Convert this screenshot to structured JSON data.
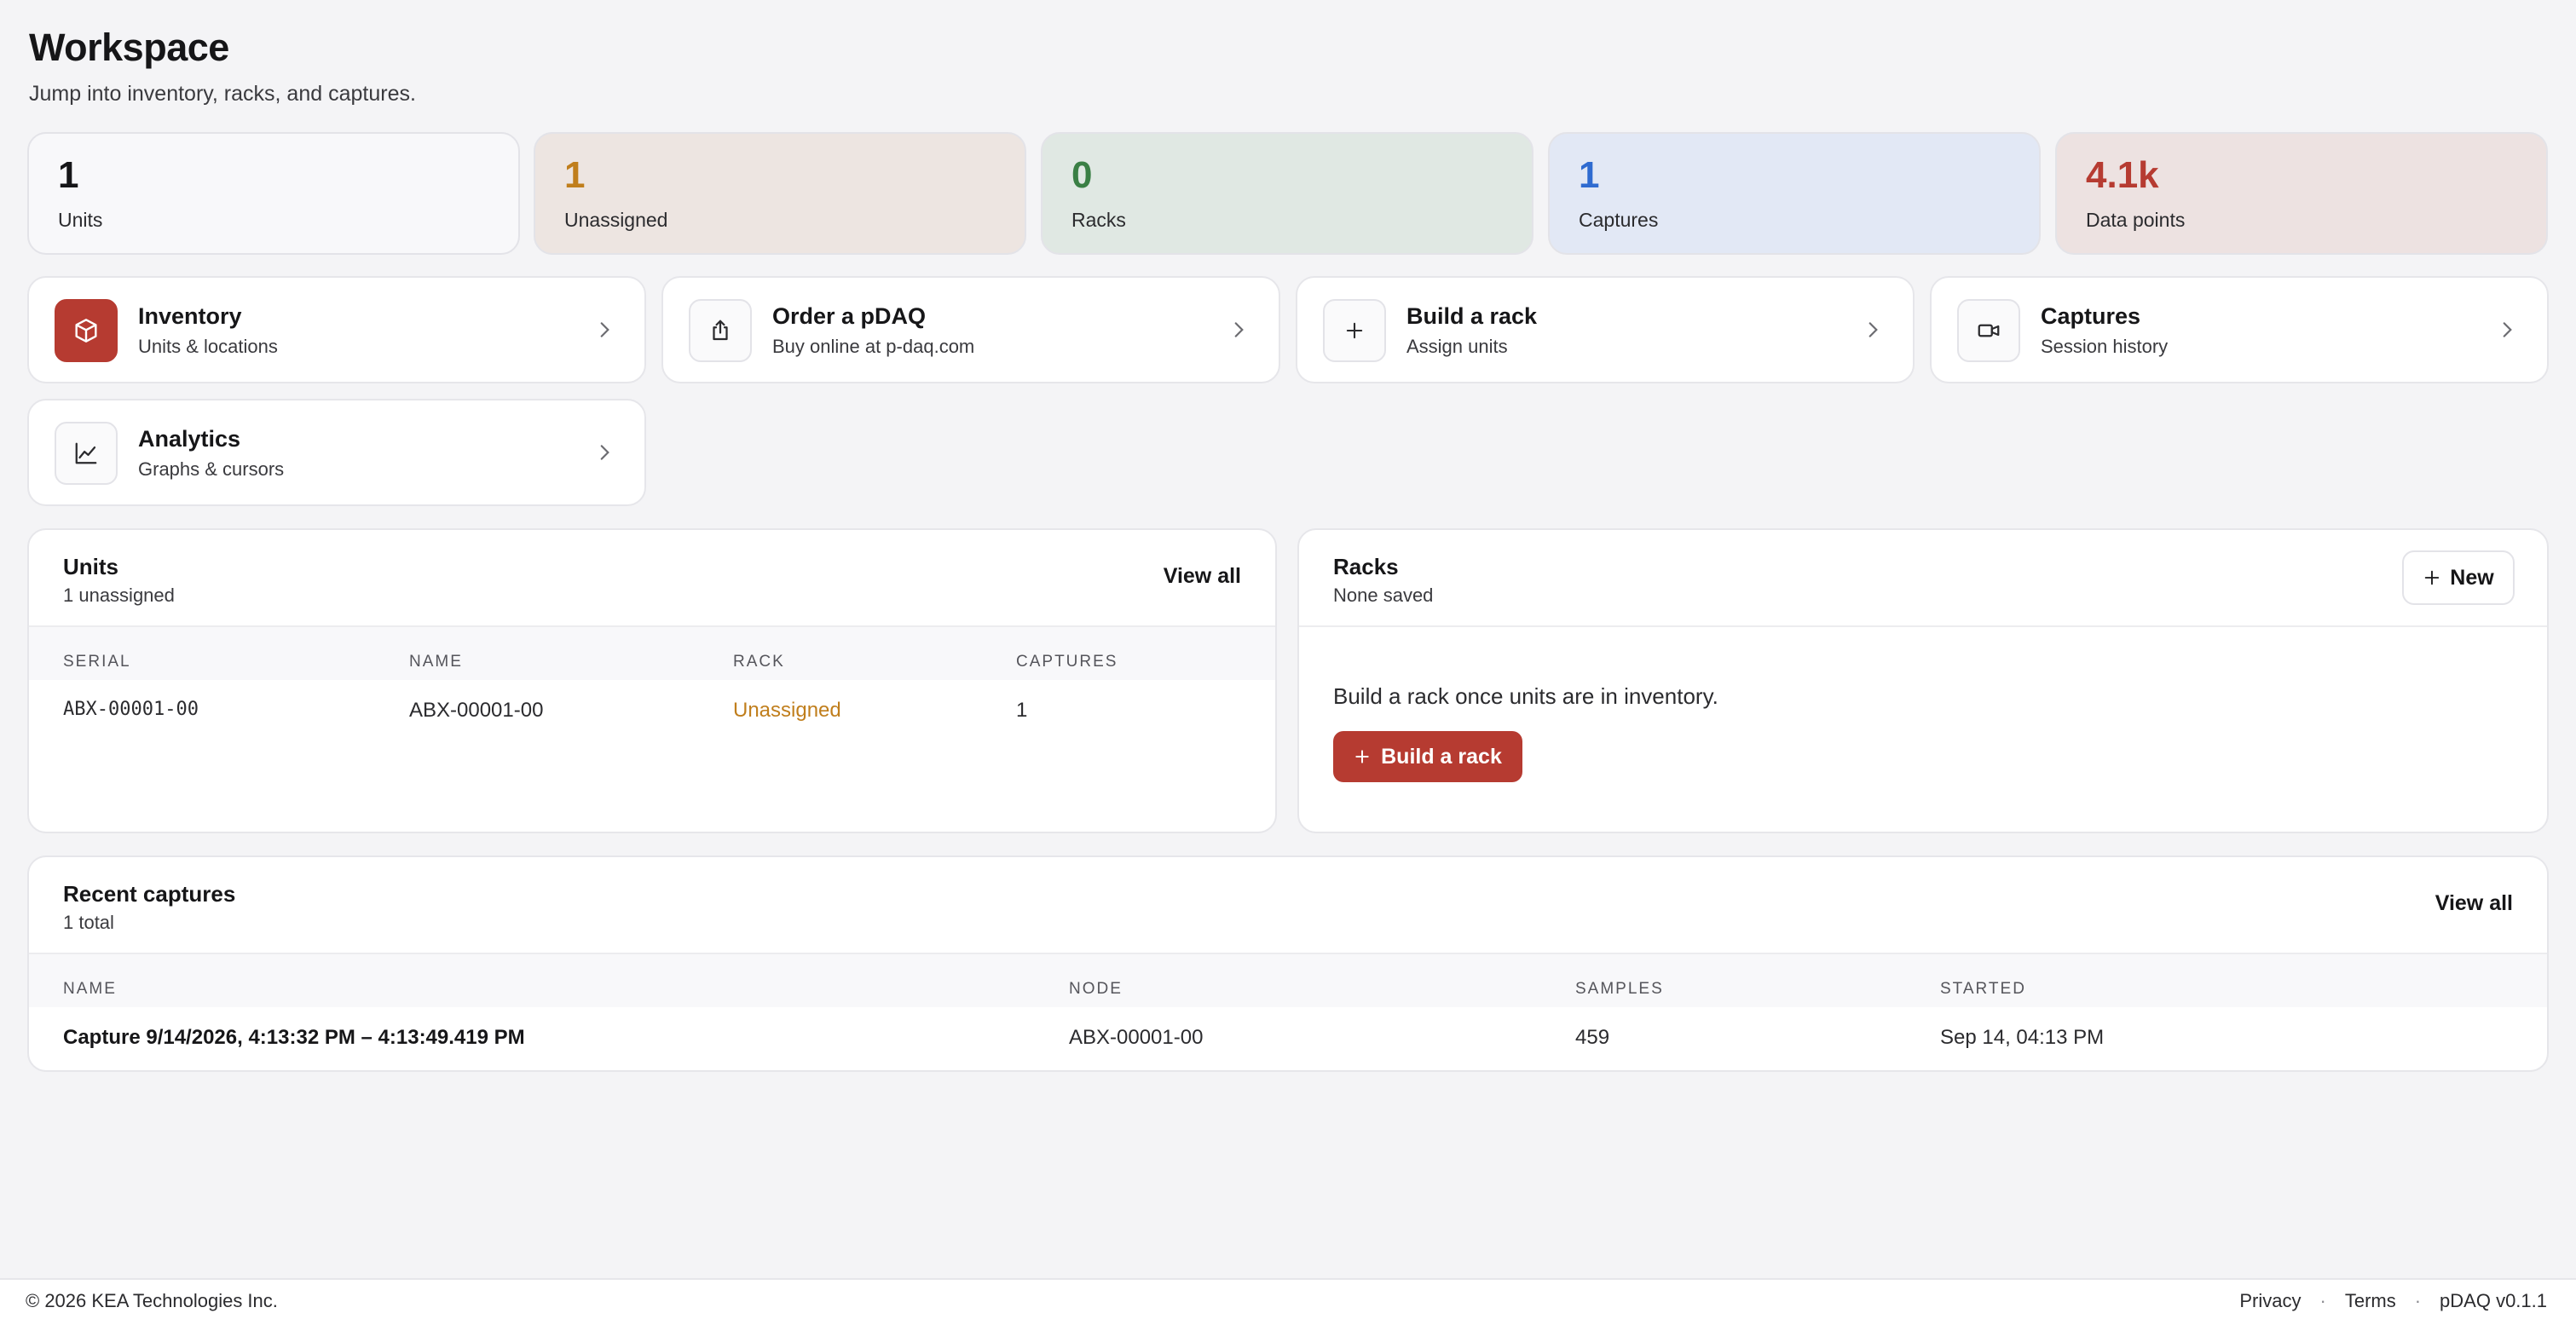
{
  "header": {
    "title": "Workspace",
    "subtitle": "Jump into inventory, racks, and captures."
  },
  "stats": [
    {
      "value": "1",
      "label": "Units",
      "color": "#161618",
      "bg": "#f8f8fa"
    },
    {
      "value": "1",
      "label": "Unassigned",
      "color": "#c07e1c",
      "bg": "#ede5e1"
    },
    {
      "value": "0",
      "label": "Racks",
      "color": "#3a7f45",
      "bg": "#e0e8e3"
    },
    {
      "value": "1",
      "label": "Captures",
      "color": "#2f6bd0",
      "bg": "#e2e8f5"
    },
    {
      "value": "4.1k",
      "label": "Data points",
      "color": "#b63b31",
      "bg": "#ede2e1"
    }
  ],
  "nav": [
    {
      "title": "Inventory",
      "subtitle": "Units & locations",
      "icon": "box-icon"
    },
    {
      "title": "Order a pDAQ",
      "subtitle": "Buy online at p-daq.com",
      "icon": "share-icon"
    },
    {
      "title": "Build a rack",
      "subtitle": "Assign units",
      "icon": "plus-icon"
    },
    {
      "title": "Captures",
      "subtitle": "Session history",
      "icon": "video-icon"
    },
    {
      "title": "Analytics",
      "subtitle": "Graphs & cursors",
      "icon": "chart-icon"
    }
  ],
  "units_panel": {
    "title": "Units",
    "subtitle": "1 unassigned",
    "link": "View all",
    "columns": [
      "SERIAL",
      "NAME",
      "RACK",
      "CAPTURES"
    ],
    "rows": [
      {
        "serial": "ABX-00001-00",
        "name": "ABX-00001-00",
        "rack": "Unassigned",
        "captures": "1"
      }
    ]
  },
  "racks_panel": {
    "title": "Racks",
    "subtitle": "None saved",
    "new_label": "New",
    "empty_text": "Build a rack once units are in inventory.",
    "build_label": "Build a rack"
  },
  "captures_panel": {
    "title": "Recent captures",
    "subtitle": "1 total",
    "link": "View all",
    "columns": [
      "NAME",
      "NODE",
      "SAMPLES",
      "STARTED"
    ],
    "rows": [
      {
        "name": "Capture 9/14/2026, 4:13:32 PM – 4:13:49.419 PM",
        "node": "ABX-00001-00",
        "samples": "459",
        "started": "Sep 14, 04:13 PM"
      }
    ]
  },
  "footer": {
    "copyright": "© 2026 KEA Technologies Inc.",
    "privacy": "Privacy",
    "terms": "Terms",
    "version": "pDAQ v0.1.1",
    "separator": "·"
  },
  "colors": {
    "accent": "#b63b31",
    "unassigned": "#c07e1c"
  }
}
